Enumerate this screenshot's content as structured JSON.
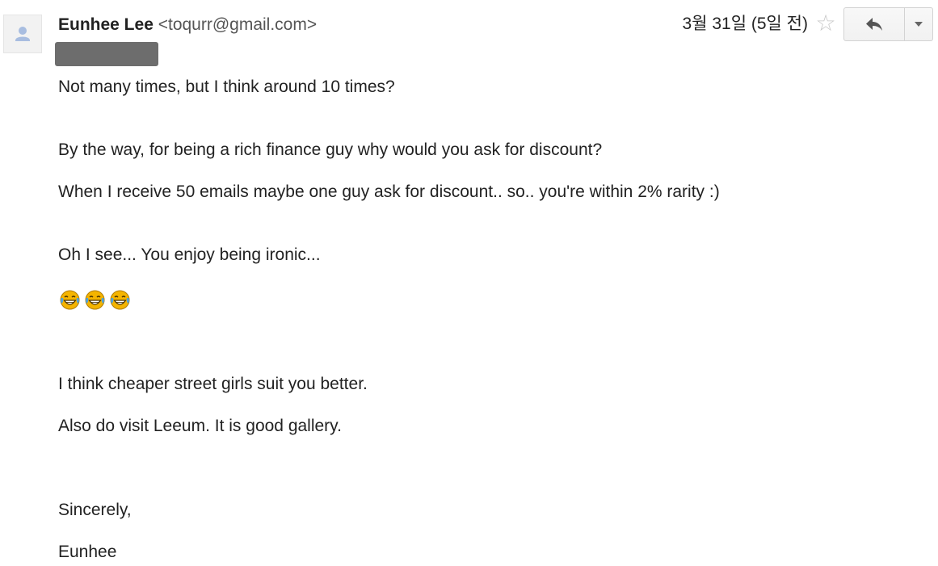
{
  "header": {
    "sender_name": "Eunhee Lee",
    "sender_email": "<toqurr@gmail.com>",
    "date": "3월 31일 (5일 전)",
    "star_icon": "star-outline-icon",
    "reply_icon": "reply-arrow-icon",
    "more_icon": "caret-down-icon"
  },
  "body": {
    "lines": [
      "Not many times, but I think around 10 times?",
      "By the way, for being a rich finance guy why would you ask for discount?",
      "When I receive 50 emails maybe one guy ask for discount.. so.. you're within 2% rarity :)",
      "Oh I see... You enjoy being ironic...",
      "I think cheaper street girls suit you better.",
      "Also do visit Leeum. It is good gallery.",
      "Sincerely,",
      "Eunhee"
    ],
    "emoji_icon": "face-tears-of-joy-icon",
    "emoji_count": 3
  },
  "colors": {
    "redaction": "#6d6d6d",
    "star": "#c6c6c6",
    "avatar_figure": "#c8d4e8",
    "emoji_face": "#f4b400"
  }
}
